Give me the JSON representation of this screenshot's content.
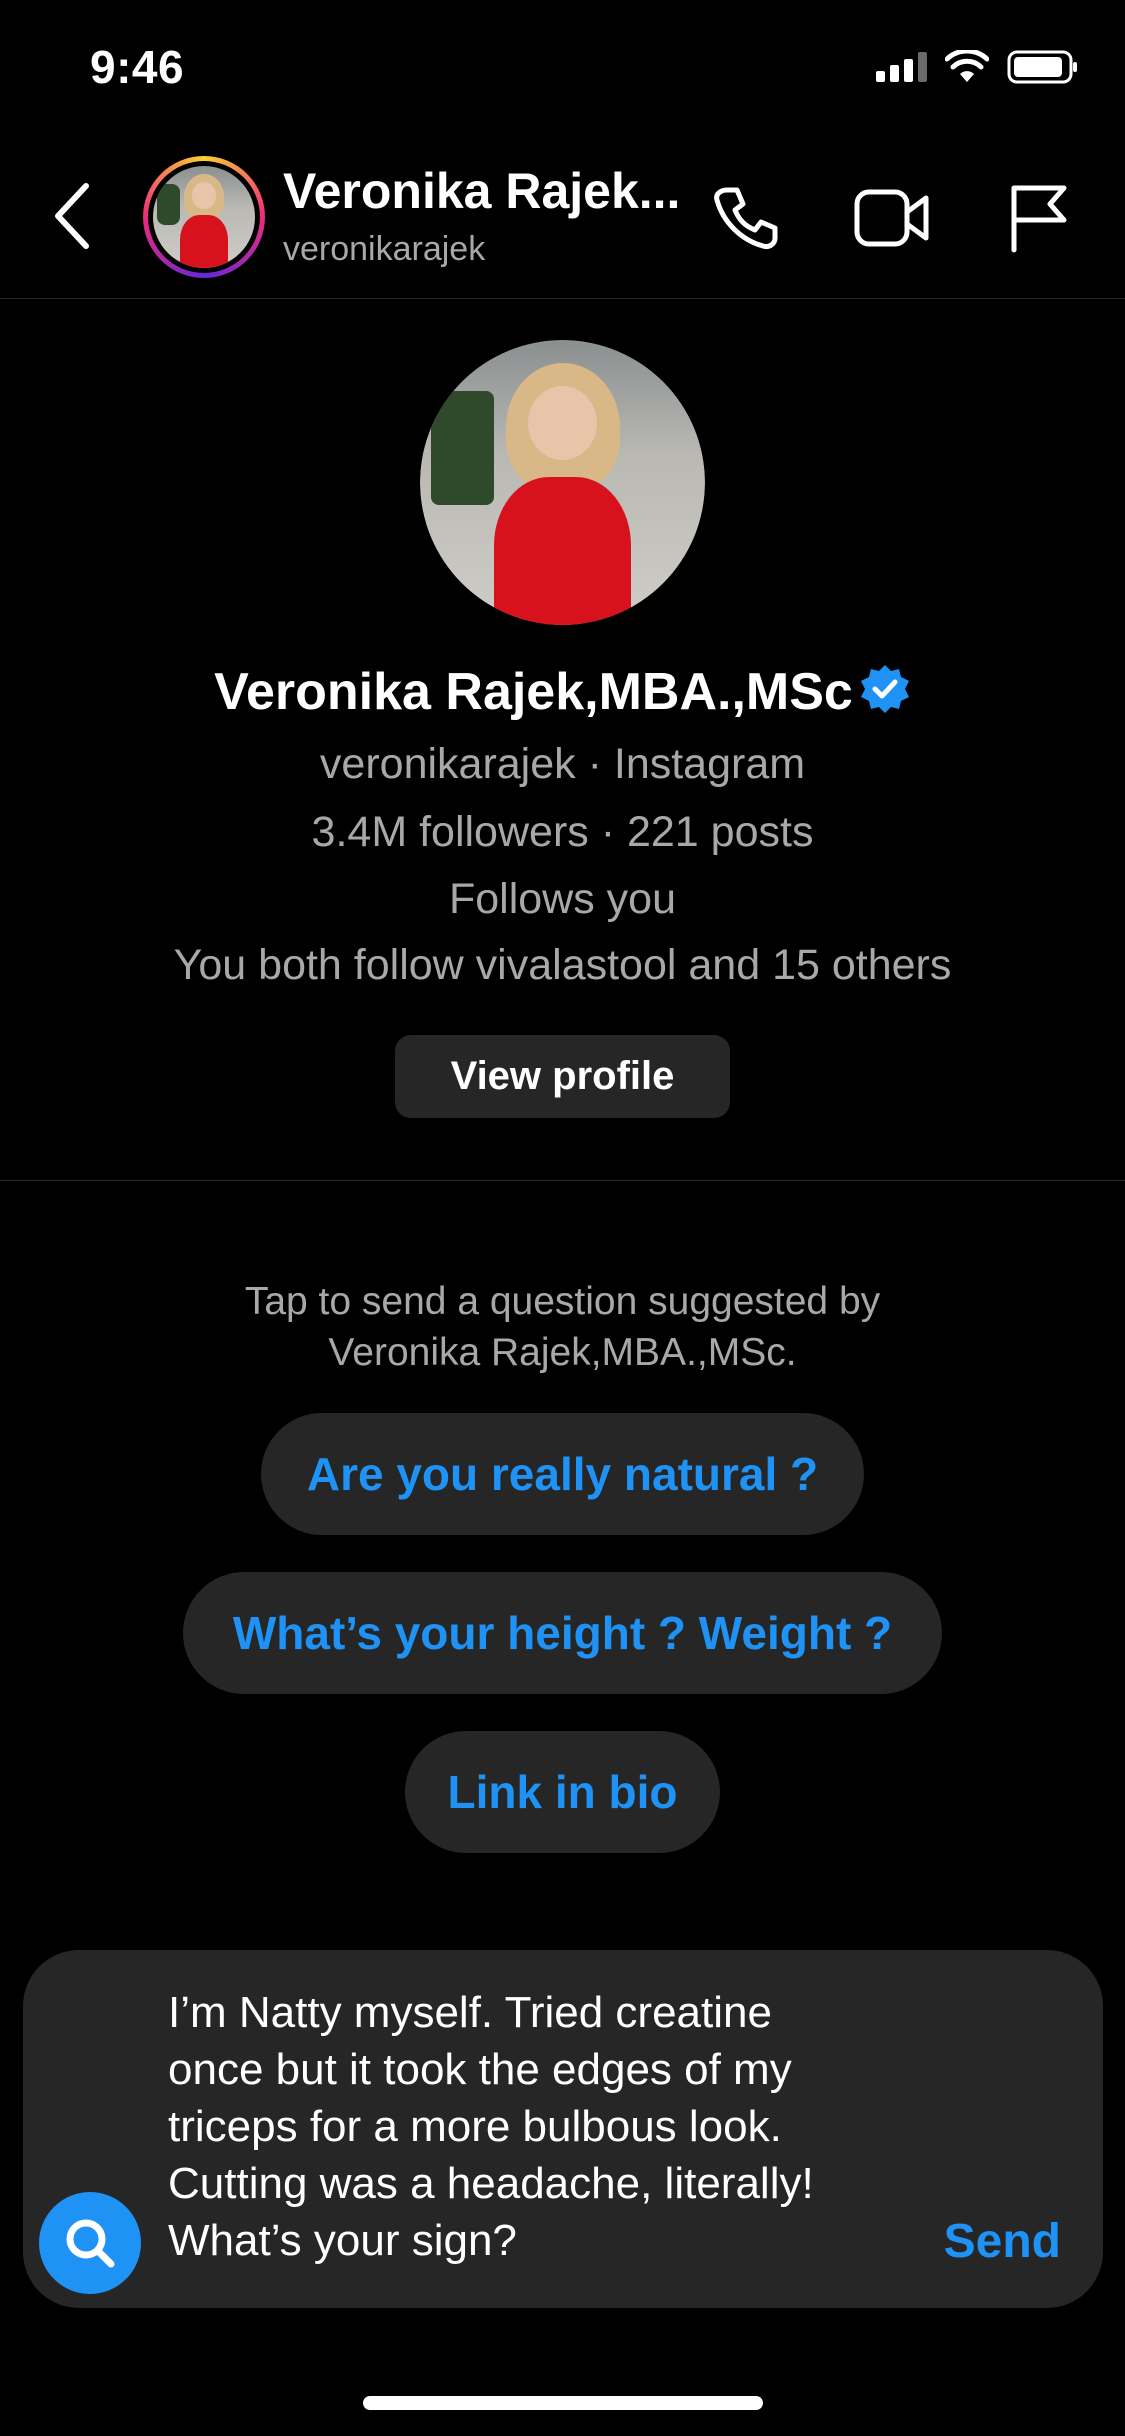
{
  "status_bar": {
    "time": "9:46"
  },
  "header": {
    "name": "Veronika Rajek...",
    "handle": "veronikarajek",
    "icons": [
      "back-arrow-icon",
      "phone-icon",
      "video-camera-icon",
      "flag-icon"
    ]
  },
  "profile": {
    "name": "Veronika Rajek,MBA.,MSc",
    "handle_line": "veronikarajek · Instagram",
    "stats_line": "3.4M followers · 221 posts",
    "follows_line": "Follows you",
    "mutual_line": "You both follow vivalastool and 15 others",
    "view_profile_label": "View profile"
  },
  "suggestions": {
    "hint": "Tap to send a question suggested by\nVeronika Rajek,MBA.,MSc.",
    "items": [
      "Are you really natural ?",
      "What’s your height ? Weight ?",
      "Link in bio"
    ]
  },
  "composer": {
    "text": "I’m Natty myself. Tried creatine\nonce but it took the edges of my\ntriceps for a more bulbous look.\nCutting was a headache, literally!\nWhat’s your sign?",
    "send_label": "Send"
  },
  "colors": {
    "accent": "#1e93f5",
    "background": "#000000",
    "surface": "#262626",
    "muted_text": "#a8a8a8"
  }
}
